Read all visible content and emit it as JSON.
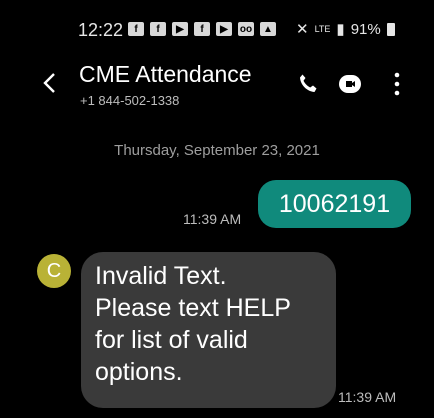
{
  "status_bar": {
    "time": "12:22",
    "notification_icons": [
      "facebook-icon",
      "facebook-icon",
      "youtube-icon",
      "facebook-icon",
      "youtube-icon",
      "voicemail-icon",
      "image-icon"
    ],
    "network": "LTE",
    "battery": "91%"
  },
  "header": {
    "contact_name": "CME Attendance",
    "contact_number": "+1 844-502-1338"
  },
  "conversation": {
    "date": "Thursday, September 23, 2021",
    "messages": [
      {
        "direction": "outgoing",
        "text": "10062191",
        "time": "11:39 AM"
      },
      {
        "direction": "incoming",
        "avatar_letter": "C",
        "lines": [
          "Invalid Text.",
          "Please text HELP",
          "for list of valid",
          "options."
        ],
        "time": "11:39 AM"
      }
    ]
  },
  "colors": {
    "outgoing_bubble": "#108a7c",
    "incoming_bubble": "#3a3a3a",
    "avatar": "#b9b236",
    "background": "#000000"
  }
}
